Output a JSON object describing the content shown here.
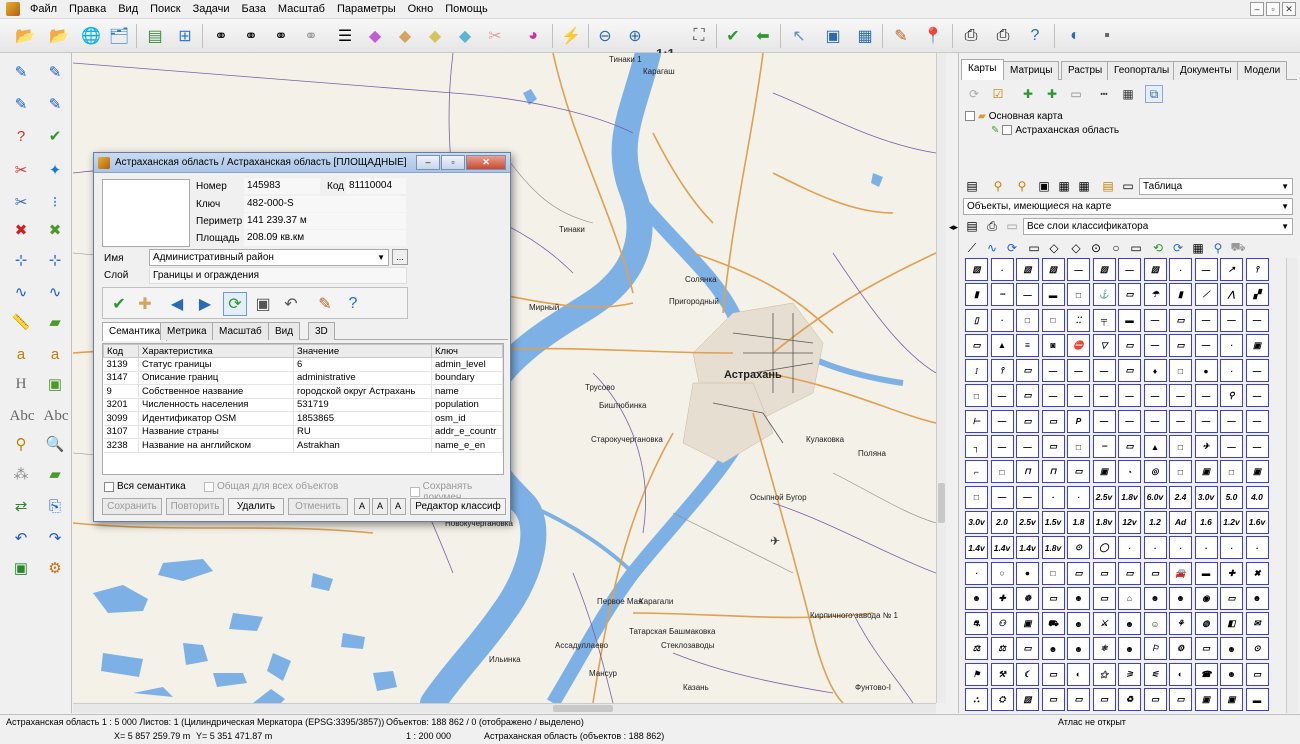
{
  "menu": [
    "Файл",
    "Правка",
    "Вид",
    "Поиск",
    "Задачи",
    "База",
    "Масштаб",
    "Параметры",
    "Окно",
    "Помощь"
  ],
  "toolbar": {
    "zoom_ratio": "1:1"
  },
  "map": {
    "labels": [
      {
        "text": "Тинаки 1",
        "cls": ""
      },
      {
        "text": "Карагаш",
        "cls": ""
      },
      {
        "text": "Тинаки",
        "cls": ""
      },
      {
        "text": "Солянка",
        "cls": ""
      },
      {
        "text": "Пригородный",
        "cls": ""
      },
      {
        "text": "Мирный",
        "cls": ""
      },
      {
        "text": "Астрахань",
        "cls": "city"
      },
      {
        "text": "Трусово",
        "cls": ""
      },
      {
        "text": "Биштюбинка",
        "cls": ""
      },
      {
        "text": "Кулаковка",
        "cls": ""
      },
      {
        "text": "Старокучергановка",
        "cls": ""
      },
      {
        "text": "Поляна",
        "cls": ""
      },
      {
        "text": "Осыпной Бугор",
        "cls": ""
      },
      {
        "text": "Новокучергановка",
        "cls": ""
      },
      {
        "text": "Первое Мая",
        "cls": ""
      },
      {
        "text": "Карагали",
        "cls": ""
      },
      {
        "text": "Кирпичного завода № 1",
        "cls": ""
      },
      {
        "text": "Татарская Башмаковка",
        "cls": ""
      },
      {
        "text": "Стеклозаводы",
        "cls": ""
      },
      {
        "text": "Ассадуллаево",
        "cls": ""
      },
      {
        "text": "Ильинка",
        "cls": ""
      },
      {
        "text": "Мансур",
        "cls": ""
      },
      {
        "text": "Казань",
        "cls": ""
      },
      {
        "text": "Фунтово-I",
        "cls": ""
      }
    ]
  },
  "dialog": {
    "title": "Астраханская область / Астраханская область [ПЛОЩАДНЫЕ]",
    "fields": {
      "number_label": "Номер",
      "number_value": "145983",
      "code_label": "Код",
      "code_value": "81110004",
      "key_label": "Ключ",
      "key_value": "482-000-S",
      "perimeter_label": "Периметр",
      "perimeter_value": "141 239.37 м",
      "area_label": "Площадь",
      "area_value": "208.09 кв.км"
    },
    "name_label": "Имя",
    "name_value": "Административный район",
    "layer_label": "Слой",
    "layer_value": "Границы и ограждения",
    "more_button": "...",
    "tabs": [
      "Семантика",
      "Метрика",
      "Масштаб",
      "Вид",
      "3D"
    ],
    "table": {
      "headers": [
        "Код",
        "Характеристика",
        "Значение",
        "Ключ"
      ],
      "rows": [
        [
          "3139",
          "Статус границы",
          "6",
          "admin_level"
        ],
        [
          "3147",
          "Описание границ",
          "administrative",
          "boundary"
        ],
        [
          "9",
          "Собственное название",
          "городской округ Астрахань",
          "name"
        ],
        [
          "3201",
          "Численность населения",
          "531719",
          "population"
        ],
        [
          "3099",
          "Идентификатор OSM",
          "1853865",
          "osm_id"
        ],
        [
          "3107",
          "Название страны",
          "RU",
          "addr_e_countr"
        ],
        [
          "3238",
          "Название на английском",
          "Astrakhan",
          "name_e_en"
        ]
      ]
    },
    "checks": {
      "all_semantics": "Вся семантика",
      "common_all": "Общая для всех объектов",
      "save_doc": "Сохранять докумен"
    },
    "actions": {
      "save": "Сохранить",
      "repeat": "Повторить",
      "delete": "Удалить",
      "cancel": "Отменить",
      "editor": "Редактор классиф"
    },
    "font_btn": "A"
  },
  "right_panel": {
    "tabs": [
      "Карты",
      "Матрицы",
      "Растры",
      "Геопорталы",
      "Документы",
      "Модели"
    ],
    "tree": {
      "root": "Основная карта",
      "child": "Астраханская область"
    },
    "view_select": "Таблица",
    "objects_select": "Объекты, имеющиеся на карте",
    "layers_select": "Все слои классификатора",
    "symbols": [
      "▧",
      "·",
      "▧",
      "▧",
      "—",
      "▧",
      "—",
      "▧",
      "·",
      "—",
      "↗",
      "⫯",
      "▮",
      "┄",
      "—",
      "▬",
      "□",
      "⚓",
      "▭",
      "☂",
      "▮",
      "⟋",
      "⋀",
      "▞",
      "▯",
      "·",
      "□",
      "□",
      "⁚⁚",
      "╤",
      "▬",
      "—",
      "▭",
      "—",
      "—",
      "—",
      "▭",
      "▲",
      "≡",
      "◙",
      "⛔",
      "▽",
      "▭",
      "—",
      "▭",
      "—",
      "·",
      "▣",
      "⁞",
      "⫯",
      "▭",
      "—",
      "—",
      "—",
      "▭",
      "♦",
      "□",
      "●",
      "·",
      "—",
      "□",
      "—",
      "▭",
      "—",
      "—",
      "—",
      "—",
      "—",
      "—",
      "—",
      "⚲",
      "—",
      "⊢",
      "—",
      "▭",
      "▭",
      "P",
      "—",
      "—",
      "—",
      "—",
      "—",
      "—",
      "—",
      "┐",
      "—",
      "—",
      "▭",
      "□",
      "┈",
      "▭",
      "▲",
      "□",
      "✈",
      "—",
      "—",
      "⌐",
      "□",
      "⊓",
      "⊓",
      "▭",
      "▣",
      "◔",
      "◎",
      "□",
      "▣",
      "□",
      "▣",
      "□",
      "—",
      "—",
      "·",
      "·",
      "2.5v",
      "1.8v",
      "6.0v",
      "2.4",
      "3.0v",
      "5.0",
      "4.0",
      "3.0v",
      "2.0",
      "2.5v",
      "1.5v",
      "1.8",
      "1.8v",
      "12v",
      "1.2",
      "Ad",
      "1.6",
      "1.2v",
      "1.6v",
      "1.4v",
      "1.4v",
      "1.4v",
      "1.8v",
      "⊙",
      "◯",
      "·",
      "·",
      "·",
      "·",
      "·",
      "·",
      "·",
      "○",
      "●",
      "□",
      "▭",
      "▭",
      "▭",
      "▭",
      "🚘",
      "▬",
      "✚",
      "✖",
      "☻",
      "✚",
      "☸",
      "▭",
      "☻",
      "▭",
      "⌂",
      "☻",
      "☻",
      "◉",
      "▭",
      "☻",
      "⛐",
      "⚇",
      "▣",
      "⛟",
      "☻",
      "⚔",
      "☻",
      "☺",
      "⚘",
      "◍",
      "◧",
      "✉",
      "⚖",
      "⚖",
      "▭",
      "☻",
      "☻",
      "⚛",
      "☻",
      "⚐",
      "⚙",
      "▭",
      "☻",
      "⊙",
      "⚑",
      "⚒",
      "☾",
      "▭",
      "◐",
      "⚝",
      "⚞",
      "⚟",
      "◐",
      "☎",
      "☻",
      "▭",
      "⛬",
      "⛭",
      "▧",
      "▭",
      "▭",
      "▭",
      "♻",
      "▭",
      "▭",
      "▣",
      "▣",
      "▬"
    ]
  },
  "status": {
    "region_scale": "Астраханская область  1 : 5 000  Листов: 1  (Цилиндрическая Меркатора (EPSG:3395/3857))",
    "objects": "Объектов: 188 862 / 0 (отображено / выделено)",
    "atlas": "Атлас не открыт",
    "coord_x": "X= 5 857 259.79 m",
    "coord_y": "Y= 5 351 471.87 m",
    "scale": "1 : 200 000",
    "region_objects": "Астраханская область  (объектов : 188 862)"
  }
}
